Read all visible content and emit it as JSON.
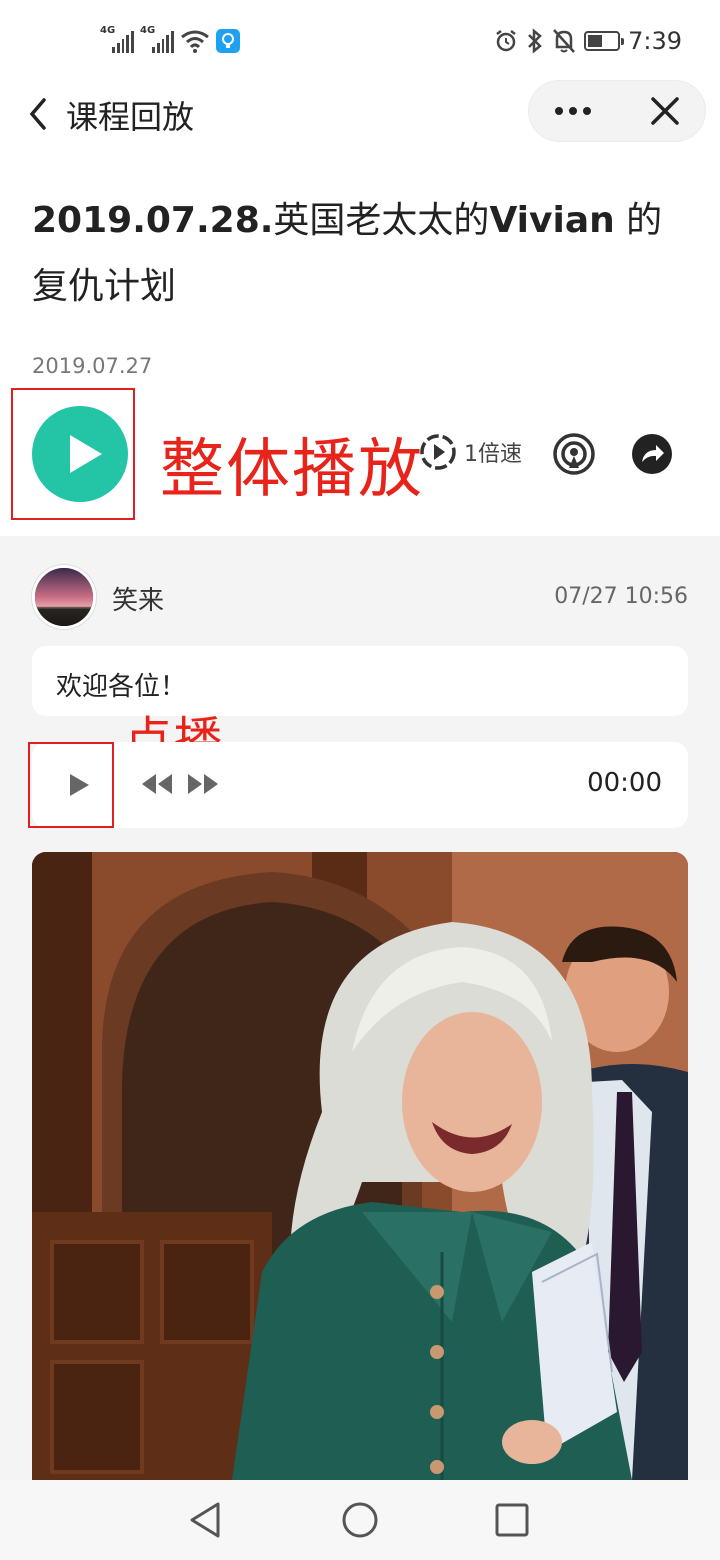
{
  "status_bar": {
    "sim1_label": "4G",
    "sim2_label": "4G",
    "time": "7:39",
    "icons": [
      "signal-icon",
      "signal-icon",
      "wifi-icon",
      "wechat-badge-icon",
      "alarm-icon",
      "bluetooth-icon",
      "mute-bell-icon",
      "battery-icon"
    ]
  },
  "navbar": {
    "title": "课程回放",
    "more_icon": "more-dots-icon",
    "close_icon": "close-icon"
  },
  "lesson": {
    "title_part1": "2019.07.28.",
    "title_part2": "英国老太太的",
    "title_part3": "Vivian",
    "title_part4": " 的复仇计划",
    "date": "2019.07.27"
  },
  "player": {
    "speed_label": "1倍速",
    "annotation_play_all": "整体播放",
    "accent_color": "#24c4a6"
  },
  "post": {
    "author": "笑来",
    "time": "07/27 10:56",
    "message": "欢迎各位！",
    "annotation_on_demand": "点播",
    "audio_duration": "00:00"
  },
  "annotation_color": "#e8231a"
}
